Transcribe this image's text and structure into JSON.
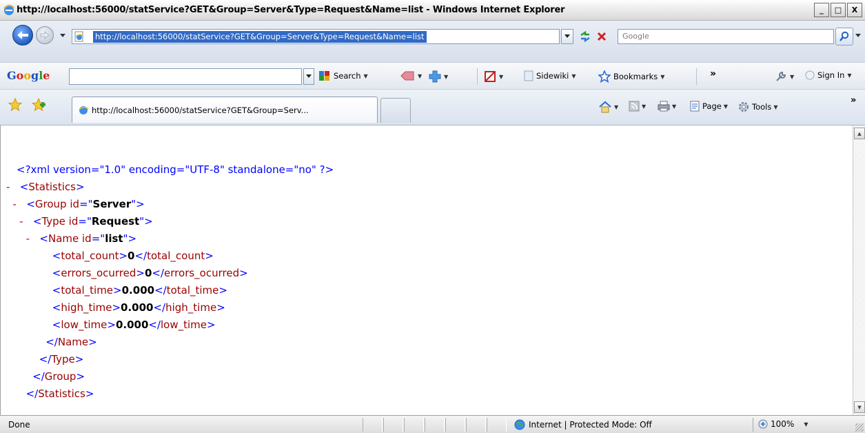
{
  "window": {
    "title": "http://localhost:56000/statService?GET&Group=Server&Type=Request&Name=list - Windows Internet Explorer",
    "buttons": [
      "_",
      "□",
      "X"
    ]
  },
  "address_bar": {
    "url": "http://localhost:56000/statService?GET&Group=Server&Type=Request&Name=list",
    "search_placeholder": "Google"
  },
  "google_toolbar": {
    "logo": "Google",
    "search_label": "Search",
    "sidewiki_label": "Sidewiki",
    "bookmarks_label": "Bookmarks",
    "more_label": "»",
    "signin_label": "Sign In"
  },
  "tabs": {
    "active_tab_label": "http://localhost:56000/statService?GET&Group=Serv...",
    "page_label": "Page",
    "tools_label": "Tools",
    "more_label": "»"
  },
  "xml": {
    "declaration": "<?xml version=\"1.0\" encoding=\"UTF-8\" standalone=\"no\" ?>",
    "root_tag": "Statistics",
    "group_tag": "Group",
    "group_id": "Server",
    "type_tag": "Type",
    "type_id": "Request",
    "name_tag": "Name",
    "name_id": "list",
    "fields": [
      {
        "tag": "total_count",
        "value": "0"
      },
      {
        "tag": "errors_ocurred",
        "value": "0"
      },
      {
        "tag": "total_time",
        "value": "0.000"
      },
      {
        "tag": "high_time",
        "value": "0.000"
      },
      {
        "tag": "low_time",
        "value": "0.000"
      }
    ]
  },
  "status_bar": {
    "status_text": "Done",
    "zone_text": "Internet | Protected Mode: Off",
    "zoom_text": "100%"
  },
  "colors": {
    "xml_tag": "#990000",
    "xml_bracket": "#0000ff",
    "xml_minus": "#c00000",
    "url_highlight": "#316ac5"
  },
  "icons": [
    "ie-page-icon",
    "back-arrow-icon",
    "forward-arrow-icon",
    "refresh-icon",
    "stop-icon",
    "search-magnifier-icon",
    "favorites-star-icon",
    "add-favorite-icon",
    "home-icon",
    "feeds-icon",
    "print-icon",
    "page-icon",
    "tools-gear-icon",
    "globe-icon",
    "zoom-icon"
  ]
}
